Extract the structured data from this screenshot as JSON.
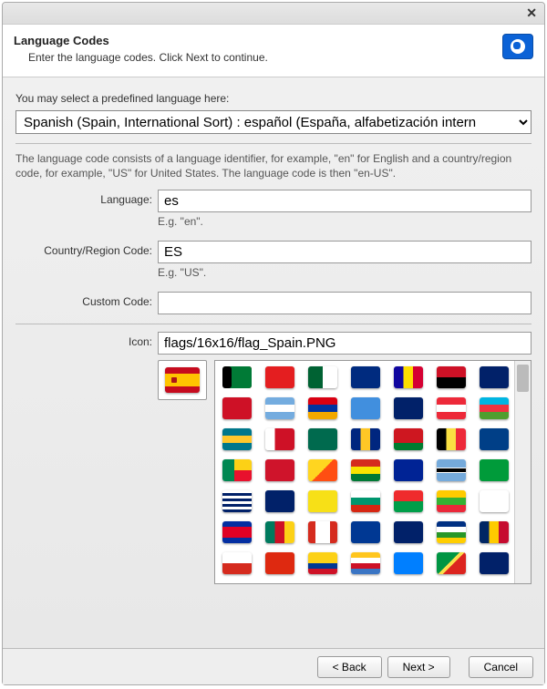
{
  "header": {
    "title": "Language Codes",
    "subtitle": "Enter the language codes. Click Next to continue."
  },
  "predef": {
    "label": "You may select a predefined language here:",
    "selected": "Spanish (Spain, International Sort) : español (España, alfabetización intern"
  },
  "help": "The language code consists of a language identifier, for example, \"en\" for English and a country/region code, for example, \"US\" for United States. The language code is then \"en-US\".",
  "fields": {
    "language": {
      "label": "Language:",
      "value": "es",
      "eg": "E.g. \"en\"."
    },
    "region": {
      "label": "Country/Region Code:",
      "value": "ES",
      "eg": "E.g. \"US\"."
    },
    "custom": {
      "label": "Custom Code:",
      "value": ""
    },
    "icon": {
      "label": "Icon:",
      "value": "flags/16x16/flag_Spain.PNG"
    }
  },
  "buttons": {
    "back": "< Back",
    "next": "Next >",
    "cancel": "Cancel"
  },
  "flag_rows": [
    [
      {
        "name": "Afghanistan",
        "css": "background:#000;box-shadow:inset -22px 0 #007a36,inset -11px 0 #d32011"
      },
      {
        "name": "Albania",
        "css": "background:#e41e20"
      },
      {
        "name": "Algeria",
        "css": "background:linear-gradient(90deg,#006233 50%,#fff 50%)"
      },
      {
        "name": "American-Samoa",
        "css": "background:#002b7f"
      },
      {
        "name": "Andorra",
        "css": "background:linear-gradient(90deg,#10069f 33%,#fedd00 33% 66%,#d50032 66%)"
      },
      {
        "name": "Angola",
        "css": "background:linear-gradient(180deg,#ce1126 50%,#000 50%)"
      },
      {
        "name": "Anguilla",
        "css": "background:#012169"
      }
    ],
    [
      {
        "name": "Antigua",
        "css": "background:#ce1126"
      },
      {
        "name": "Argentina",
        "css": "background:linear-gradient(180deg,#74acdf 33%,#fff 33% 66%,#74acdf 66%)"
      },
      {
        "name": "Armenia",
        "css": "background:linear-gradient(180deg,#d90012 33%,#0033a0 33% 66%,#f2a800 66%)"
      },
      {
        "name": "Aruba",
        "css": "background:#418fde"
      },
      {
        "name": "Australia",
        "css": "background:#012169"
      },
      {
        "name": "Austria",
        "css": "background:linear-gradient(180deg,#ed2939 33%,#fff 33% 66%,#ed2939 66%)"
      },
      {
        "name": "Azerbaijan",
        "css": "background:linear-gradient(180deg,#00b5e2 33%,#ef3340 33% 66%,#509e2f 66%)"
      }
    ],
    [
      {
        "name": "Bahamas",
        "css": "background:linear-gradient(180deg,#00778b 33%,#ffc72c 33% 66%,#00778b 66%)"
      },
      {
        "name": "Bahrain",
        "css": "background:linear-gradient(90deg,#fff 33%,#ce1126 33%)"
      },
      {
        "name": "Bangladesh",
        "css": "background:#006a4e"
      },
      {
        "name": "Barbados",
        "css": "background:linear-gradient(90deg,#00267f 33%,#ffc726 33% 66%,#00267f 66%)"
      },
      {
        "name": "Belarus",
        "css": "background:linear-gradient(180deg,#ce1720 66%,#007c30 66%)"
      },
      {
        "name": "Belgium",
        "css": "background:linear-gradient(90deg,#000 33%,#fae042 33% 66%,#ed2939 66%)"
      },
      {
        "name": "Belize",
        "css": "background:#003f87"
      }
    ],
    [
      {
        "name": "Benin",
        "css": "background:linear-gradient(90deg,#008751 40%,transparent 40%),linear-gradient(180deg,#fcd116 50%,#e8112d 50%)"
      },
      {
        "name": "Bermuda",
        "css": "background:#cf142b"
      },
      {
        "name": "Bhutan",
        "css": "background:linear-gradient(135deg,#ffd520 50%,#ff4e12 50%)"
      },
      {
        "name": "Bolivia",
        "css": "background:linear-gradient(180deg,#d52b1e 33%,#f9e300 33% 66%,#007934 66%)"
      },
      {
        "name": "Bosnia",
        "css": "background:#002395"
      },
      {
        "name": "Botswana",
        "css": "background:linear-gradient(180deg,#75aadb 38%,#fff 38% 42%,#000 42% 58%,#fff 58% 62%,#75aadb 62%)"
      },
      {
        "name": "Brazil",
        "css": "background:#009b3a"
      }
    ],
    [
      {
        "name": "BIOT",
        "css": "background:repeating-linear-gradient(180deg,#fff 0 3px,#012169 3px 6px)"
      },
      {
        "name": "BVI",
        "css": "background:#012169"
      },
      {
        "name": "Brunei",
        "css": "background:#f7e017"
      },
      {
        "name": "Bulgaria",
        "css": "background:linear-gradient(180deg,#fff 33%,#00966e 33% 66%,#d62612 66%)"
      },
      {
        "name": "Burkina",
        "css": "background:linear-gradient(180deg,#ef2b2d 50%,#009e49 50%)"
      },
      {
        "name": "Burma",
        "css": "background:linear-gradient(180deg,#fecb00 33%,#34b233 33% 66%,#ea2839 66%)"
      },
      {
        "name": "Burundi",
        "css": "background:#fff"
      }
    ],
    [
      {
        "name": "Cambodia",
        "css": "background:linear-gradient(180deg,#032ea1 25%,#e00025 25% 75%,#032ea1 75%)"
      },
      {
        "name": "Cameroon",
        "css": "background:linear-gradient(90deg,#007a5e 33%,#ce1126 33% 66%,#fcd116 66%)"
      },
      {
        "name": "Canada",
        "css": "background:linear-gradient(90deg,#d52b1e 25%,#fff 25% 75%,#d52b1e 75%)"
      },
      {
        "name": "CapeVerde",
        "css": "background:#003893"
      },
      {
        "name": "Cayman",
        "css": "background:#012169"
      },
      {
        "name": "CAR",
        "css": "background:linear-gradient(180deg,#003082 25%,#fff 25% 50%,#289728 50% 75%,#ffce00 75%)"
      },
      {
        "name": "Chad",
        "css": "background:linear-gradient(90deg,#002664 33%,#fecb00 33% 66%,#c60c30 66%)"
      }
    ],
    [
      {
        "name": "Chile",
        "css": "background:linear-gradient(180deg,#fff 50%,#d52b1e 50%)"
      },
      {
        "name": "China",
        "css": "background:#de2910"
      },
      {
        "name": "Colombia",
        "css": "background:linear-gradient(180deg,#fcd116 50%,#003893 50% 75%,#ce1126 75%)"
      },
      {
        "name": "Comoros",
        "css": "background:linear-gradient(180deg,#ffc61e 25%,#fff 25% 50%,#ce1126 50% 75%,#3a75c4 75%)"
      },
      {
        "name": "DRCongo",
        "css": "background:#007fff"
      },
      {
        "name": "RCongo",
        "css": "background:linear-gradient(135deg,#009543 45%,#fbde4a 45% 55%,#dc241f 55%)"
      },
      {
        "name": "CookIs",
        "css": "background:#012169"
      }
    ]
  ]
}
